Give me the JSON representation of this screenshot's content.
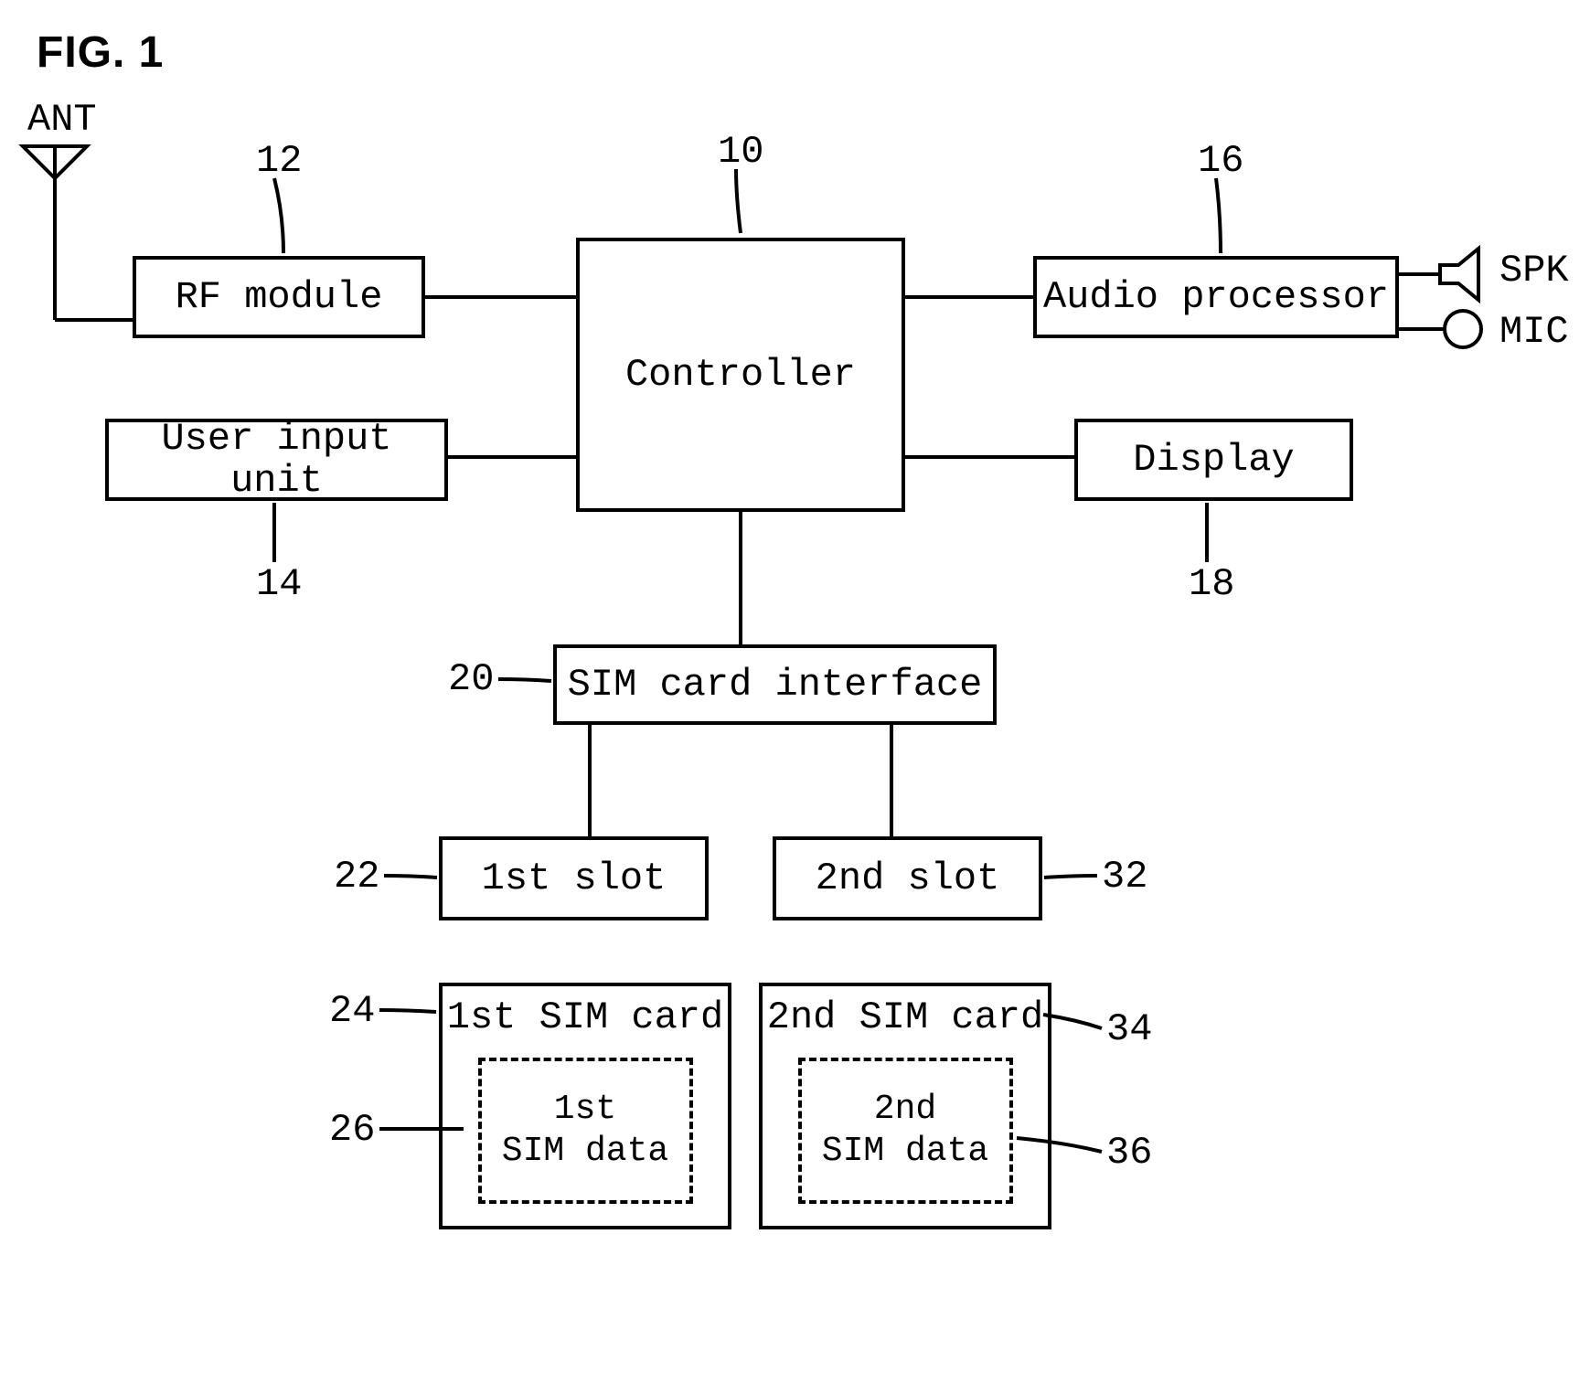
{
  "figure_title": "FIG. 1",
  "refs": {
    "controller": "10",
    "rf_module": "12",
    "user_input": "14",
    "audio_processor": "16",
    "display": "18",
    "sim_interface": "20",
    "slot1": "22",
    "sim_card1": "24",
    "sim_data1": "26",
    "slot2": "32",
    "sim_card2": "34",
    "sim_data2": "36"
  },
  "blocks": {
    "controller": "Controller",
    "rf_module": "RF module",
    "user_input": "User input unit",
    "audio_processor": "Audio processor",
    "display": "Display",
    "sim_interface": "SIM card interface",
    "slot1": "1st slot",
    "slot2": "2nd slot",
    "sim_card1": "1st SIM card",
    "sim_data1": "1st\nSIM data",
    "sim_card2": "2nd SIM card",
    "sim_data2": "2nd\nSIM data"
  },
  "periph": {
    "ant": "ANT",
    "spk": "SPK",
    "mic": "MIC"
  }
}
